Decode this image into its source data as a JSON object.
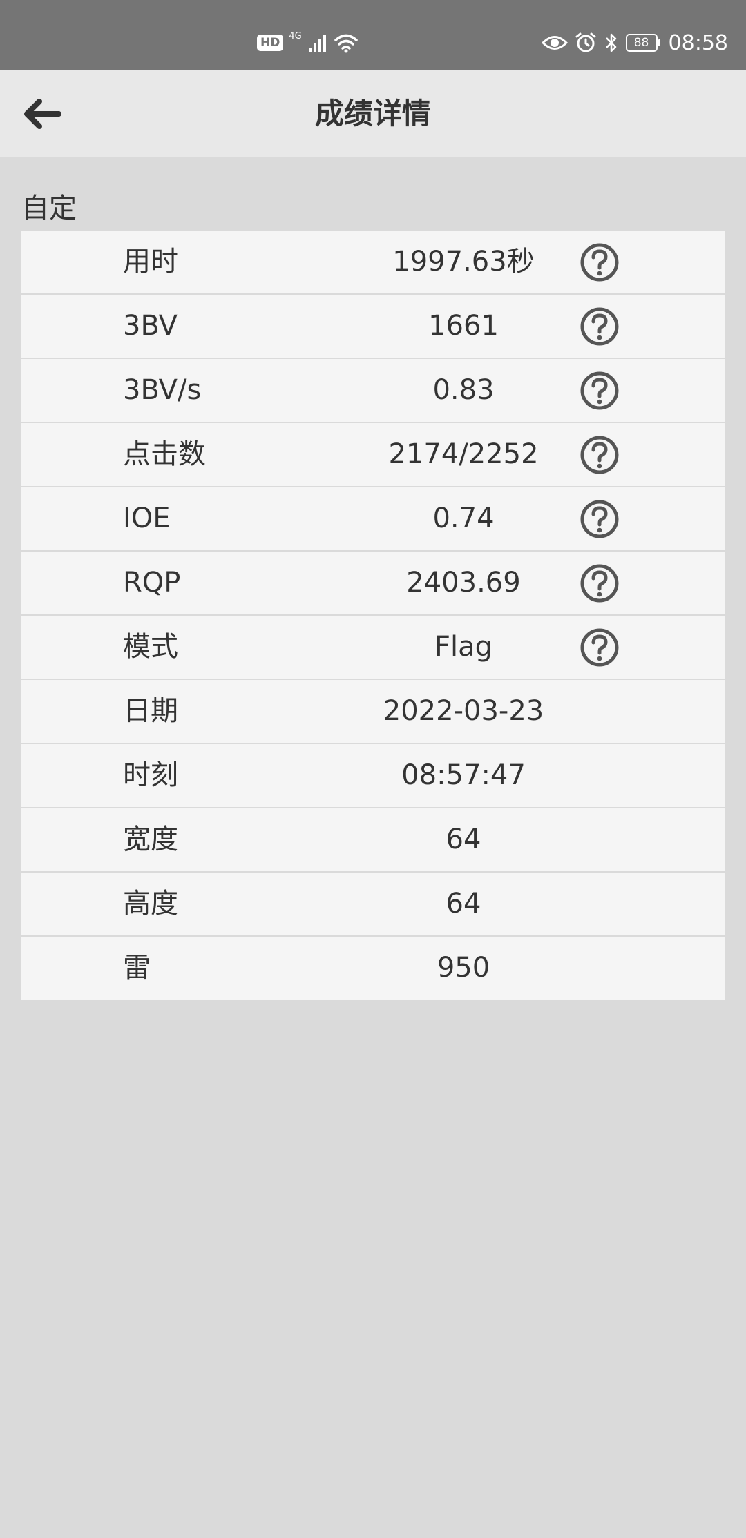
{
  "status_bar": {
    "hd": "HD",
    "network": "4G",
    "battery": "88",
    "time": "08:58",
    "icons": [
      "hd-icon",
      "signal-icon",
      "wifi-icon",
      "eye-icon",
      "alarm-icon",
      "bluetooth-icon",
      "battery-icon"
    ]
  },
  "toolbar": {
    "title": "成绩详情",
    "back_icon": "arrow-left-icon"
  },
  "section": {
    "label": "自定"
  },
  "rows": [
    {
      "label": "用时",
      "value": "1997.63秒",
      "help": true
    },
    {
      "label": "3BV",
      "value": "1661",
      "help": true
    },
    {
      "label": "3BV/s",
      "value": "0.83",
      "help": true
    },
    {
      "label": "点击数",
      "value": "2174/2252",
      "help": true
    },
    {
      "label": "IOE",
      "value": "0.74",
      "help": true
    },
    {
      "label": "RQP",
      "value": "2403.69",
      "help": true
    },
    {
      "label": "模式",
      "value": "Flag",
      "help": true
    },
    {
      "label": "日期",
      "value": "2022-03-23",
      "help": false
    },
    {
      "label": "时刻",
      "value": "08:57:47",
      "help": false
    },
    {
      "label": "宽度",
      "value": "64",
      "help": false
    },
    {
      "label": "高度",
      "value": "64",
      "help": false
    },
    {
      "label": "雷",
      "value": "950",
      "help": false
    }
  ],
  "colors": {
    "status_bar": "#757575",
    "toolbar": "#e8e8e8",
    "background": "#dadada",
    "card": "#f5f5f5",
    "text": "#333333"
  }
}
